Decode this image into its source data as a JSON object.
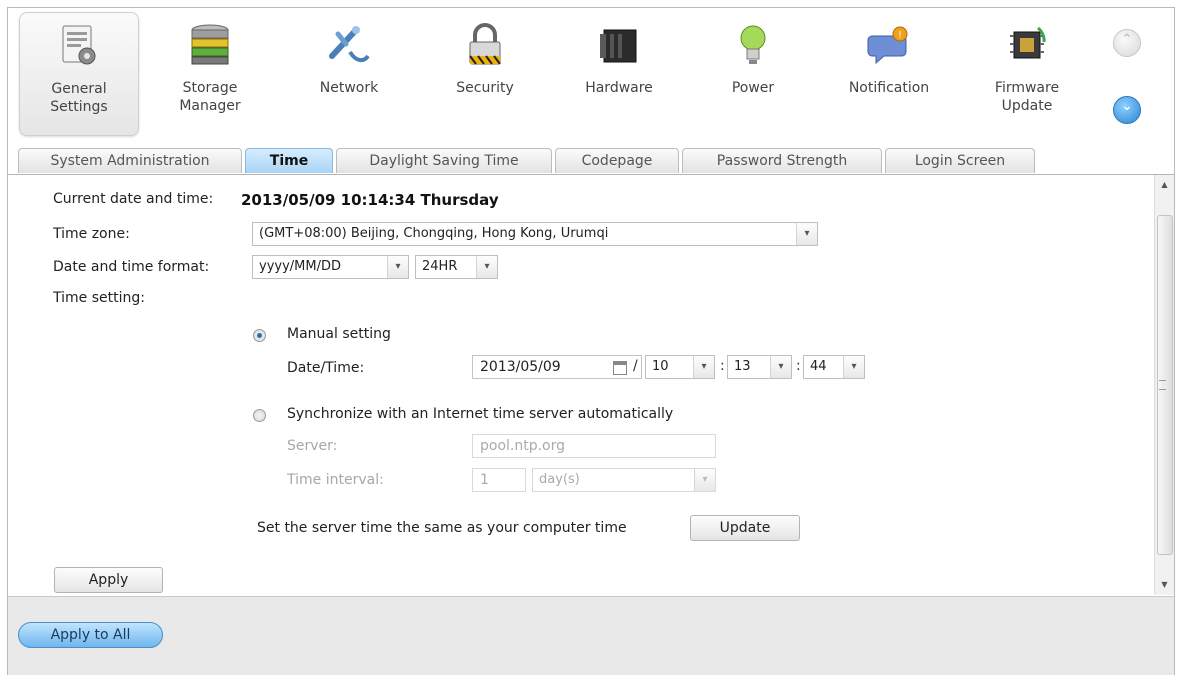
{
  "nav": {
    "items": [
      {
        "label": "General\nSettings",
        "icon": "general-settings-icon",
        "active": true
      },
      {
        "label": "Storage\nManager",
        "icon": "storage-manager-icon"
      },
      {
        "label": "Network",
        "icon": "network-icon"
      },
      {
        "label": "Security",
        "icon": "lock-icon"
      },
      {
        "label": "Hardware",
        "icon": "hardware-icon"
      },
      {
        "label": "Power",
        "icon": "power-bulb-icon"
      },
      {
        "label": "Notification",
        "icon": "notification-icon"
      },
      {
        "label": "Firmware\nUpdate",
        "icon": "firmware-update-icon"
      }
    ],
    "scroll_up": "⌃",
    "scroll_down": "⌄"
  },
  "tabs": [
    {
      "label": "System Administration"
    },
    {
      "label": "Time",
      "active": true
    },
    {
      "label": "Daylight Saving Time"
    },
    {
      "label": "Codepage"
    },
    {
      "label": "Password Strength"
    },
    {
      "label": "Login Screen"
    }
  ],
  "time": {
    "current_label": "Current date and time:",
    "current_value": "2013/05/09 10:14:34 Thursday",
    "timezone_label": "Time zone:",
    "timezone_value": "(GMT+08:00) Beijing, Chongqing, Hong Kong, Urumqi",
    "format_label": "Date and time format:",
    "date_format": "yyyy/MM/DD",
    "hour_format": "24HR",
    "setting_label": "Time setting:",
    "manual_label": "Manual setting",
    "datetime_label": "Date/Time:",
    "date_value": "2013/05/09",
    "slash": "/",
    "hour": "10",
    "colon": ":",
    "minute": "13",
    "second": "44",
    "sync_label": "Synchronize with an Internet time server automatically",
    "server_label": "Server:",
    "server_value": "pool.ntp.org",
    "interval_label": "Time interval:",
    "interval_value": "1",
    "interval_unit": "day(s)",
    "same_time_label": "Set the server time the same as your computer time",
    "update_button": "Update",
    "apply_button": "Apply"
  },
  "footer": {
    "apply_all_button": "Apply to All"
  },
  "colors": {
    "active_tab": "#a9d3f5",
    "apply_all": "#6fb6ee"
  }
}
